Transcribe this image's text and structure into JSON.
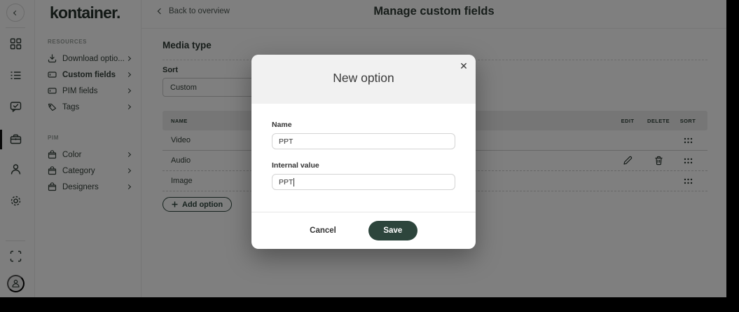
{
  "colors": {
    "primary": "#2d453c",
    "overlay": "rgba(0,0,0,0.5)",
    "table_header_bg": "#ececec",
    "modal_header_bg": "#f1f1f1"
  },
  "sidebar": {
    "logo": "kontainer.",
    "sections": [
      {
        "label": "RESOURCES",
        "items": [
          {
            "label": "Download optio...",
            "icon": "download-icon"
          },
          {
            "label": "Custom fields",
            "icon": "field-icon",
            "active": true
          },
          {
            "label": "PIM fields",
            "icon": "field-icon"
          },
          {
            "label": "Tags",
            "icon": "tag-icon"
          }
        ]
      },
      {
        "label": "PIM",
        "items": [
          {
            "label": "Color",
            "icon": "bag-icon"
          },
          {
            "label": "Category",
            "icon": "bag-icon"
          },
          {
            "label": "Designers",
            "icon": "bag-icon"
          }
        ]
      }
    ]
  },
  "rail": {
    "icons": [
      "collapse-icon",
      "grid-icon",
      "list-icon",
      "chat-icon",
      "briefcase-icon",
      "person-icon",
      "gear-icon",
      "frame-icon",
      "avatar-icon"
    ],
    "active_icon": "briefcase-icon"
  },
  "header": {
    "back_label": "Back to overview",
    "title": "Manage custom fields"
  },
  "content": {
    "section_title": "Media type",
    "sort_label": "Sort",
    "sort_value": "Custom",
    "table": {
      "columns": [
        "NAME",
        "EDIT",
        "DELETE",
        "SORT"
      ],
      "rows": [
        {
          "name": "Video",
          "actions_visible": false
        },
        {
          "name": "Audio",
          "actions_visible": true
        },
        {
          "name": "Image",
          "actions_visible": false
        }
      ]
    },
    "add_option_label": "Add option"
  },
  "modal": {
    "title": "New option",
    "close_label": "✕",
    "fields": [
      {
        "label": "Name",
        "value": "PPT"
      },
      {
        "label": "Internal value",
        "value": "PPT",
        "caret": true
      }
    ],
    "cancel_label": "Cancel",
    "save_label": "Save"
  }
}
